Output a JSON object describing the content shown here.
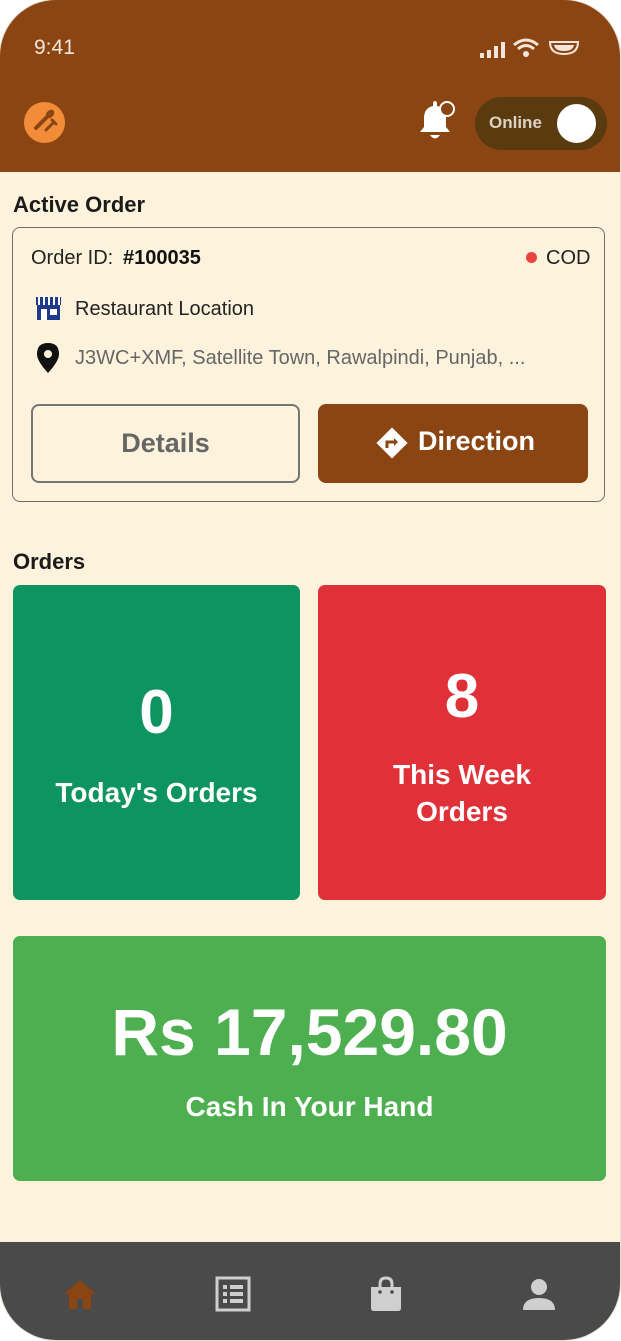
{
  "status_bar": {
    "time": "9:41"
  },
  "header": {
    "logo_icon": "food-logo-icon",
    "notification_icon": "bell-icon",
    "toggle": {
      "label": "Online",
      "state": "on"
    }
  },
  "active_order": {
    "title": "Active Order",
    "order_id_label": "Order ID:",
    "order_id_value": "#100035",
    "payment_method": "COD",
    "restaurant_label": "Restaurant Location",
    "address": "J3WC+XMF, Satellite Town, Rawalpindi, Punjab, ...",
    "details_button": "Details",
    "direction_button": "Direction"
  },
  "orders": {
    "title": "Orders",
    "today": {
      "count": "0",
      "label": "Today's Orders"
    },
    "week": {
      "count": "8",
      "label_line1": "This Week",
      "label_line2": "Orders"
    }
  },
  "cash": {
    "amount": "Rs 17,529.80",
    "label": "Cash In Your Hand"
  },
  "bottom_nav": {
    "items": [
      {
        "icon": "home-icon",
        "active": true
      },
      {
        "icon": "orders-list-icon",
        "active": false
      },
      {
        "icon": "shopping-bag-icon",
        "active": false
      },
      {
        "icon": "profile-icon",
        "active": false
      }
    ]
  },
  "colors": {
    "brand": "#8B4513",
    "background": "#FDF3DC",
    "today_tile": "#0E9460",
    "week_tile": "#E03038",
    "cash_tile": "#4DAF4F",
    "cod_dot": "#E8433F",
    "nav_bar": "#4A4A4A",
    "nav_active": "#8B4513"
  }
}
